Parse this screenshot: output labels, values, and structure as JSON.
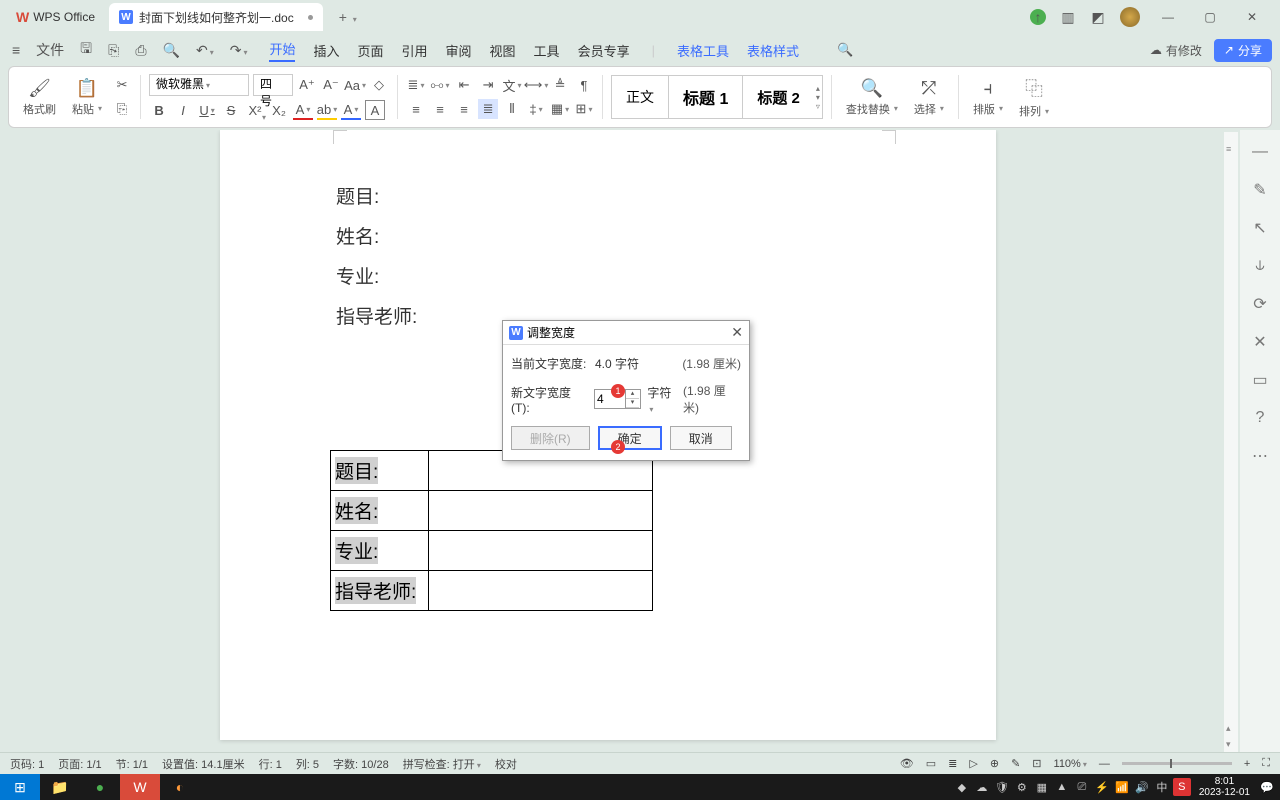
{
  "titlebar": {
    "app_name": "WPS Office",
    "doc_name": "封面下划线如何整齐划一.doc",
    "new_tab": "+"
  },
  "menubar": {
    "file": "文件",
    "tabs": [
      "开始",
      "插入",
      "页面",
      "引用",
      "审阅",
      "视图",
      "工具",
      "会员专享"
    ],
    "extra": [
      "表格工具",
      "表格样式"
    ],
    "has_change": "有修改",
    "share": "分享"
  },
  "ribbon": {
    "format_painter": "格式刷",
    "paste": "粘贴",
    "font_name": "微软雅黑",
    "font_size": "四号",
    "styles": {
      "normal": "正文",
      "h1": "标题 1",
      "h2": "标题 2"
    },
    "find_replace": "查找替换",
    "select": "选择",
    "layout": "排版",
    "arrange": "排列"
  },
  "doc": {
    "lines": [
      "题目:",
      "姓名:",
      "专业:",
      "指导老师:"
    ],
    "table": [
      "题目:",
      "姓名:",
      "专业:",
      "指导老师:"
    ]
  },
  "dialog": {
    "title": "调整宽度",
    "cur_label": "当前文字宽度:",
    "cur_val": "4.0 字符",
    "cur_cm": "(1.98 厘米)",
    "new_label": "新文字宽度(T):",
    "new_val": "4",
    "unit_label": "字符",
    "new_cm": "(1.98 厘米)",
    "delete": "删除(R)",
    "ok": "确定",
    "cancel": "取消"
  },
  "status": {
    "page_no": "页码: 1",
    "page": "页面: 1/1",
    "section": "节: 1/1",
    "pos": "设置值: 14.1厘米",
    "row": "行: 1",
    "col": "列: 5",
    "chars": "字数: 10/28",
    "spell": "拼写检查: 打开",
    "proof": "校对",
    "zoom": "110%"
  },
  "taskbar": {
    "time": "8:01",
    "date": "2023-12-01",
    "ime": "中"
  }
}
